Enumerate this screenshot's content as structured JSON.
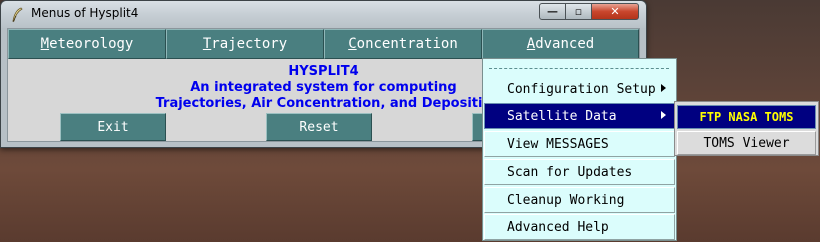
{
  "window": {
    "title": "Menus of Hysplit4",
    "minimize_label": "—",
    "maximize_label": "▫",
    "close_label": "✕"
  },
  "menubar": {
    "items": [
      {
        "first": "M",
        "rest": "eteorology"
      },
      {
        "first": "T",
        "rest": "rajectory"
      },
      {
        "first": "C",
        "rest": "oncentration"
      },
      {
        "first": "A",
        "rest": "dvanced"
      }
    ]
  },
  "main": {
    "heading": "HYSPLIT4",
    "line1": "An integrated system for computing",
    "line2": "Trajectories, Air Concentration, and Depositio",
    "buttons": {
      "exit": "Exit",
      "reset": "Reset"
    }
  },
  "dropdown": {
    "items": [
      {
        "label": "Configuration Setup"
      },
      {
        "label": "Satellite Data"
      },
      {
        "label": "View MESSAGES"
      },
      {
        "label": "Scan for Updates"
      },
      {
        "label": "Cleanup Working"
      },
      {
        "label": "Advanced Help"
      }
    ]
  },
  "submenu": {
    "items": [
      {
        "label": "FTP NASA TOMS"
      },
      {
        "label": "TOMS Viewer"
      }
    ]
  },
  "colors": {
    "menu_button": "#4a7f80",
    "dropdown_bg": "#dbfdfc",
    "selected": "#000080",
    "heading_text": "#0000ee"
  }
}
